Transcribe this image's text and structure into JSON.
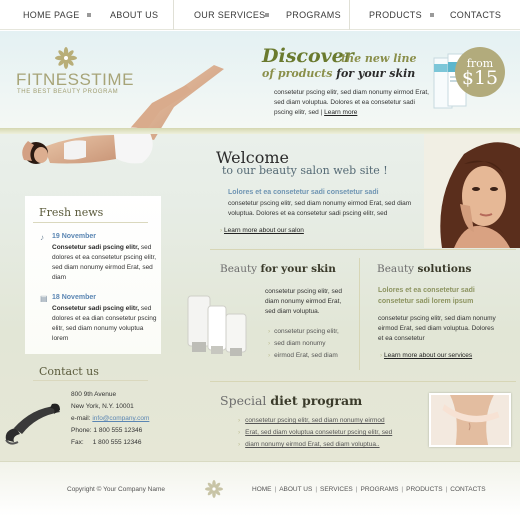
{
  "nav": {
    "items": [
      "HOME PAGE",
      "ABOUT US",
      "OUR SERVICES",
      "PROGRAMS",
      "PRODUCTS",
      "CONTACTS"
    ]
  },
  "logo": {
    "title_a": "FITNESS",
    "title_b": "TIME",
    "subtitle": "THE BEST BEAUTY PROGRAM"
  },
  "discover": {
    "headline": "Discover",
    "line1": "the new line",
    "line2": "of products",
    "line2_b": "for your skin",
    "body": "consetetur pscing elitr, sed diam nonumy eirmod Erat, sed diam voluptua. Dolores et ea consetetur sadi pscing elitr, sed |",
    "more": "Learn more"
  },
  "badge": {
    "from": "from",
    "price": "$15"
  },
  "welcome": {
    "title": "Welcome",
    "subtitle": "to our beauty salon web site !",
    "lead": "Lolores et ea consetetur sadi consetetur sadi",
    "body": "consetetur pscing elitr, sed diam nonumy eirmod Erat, sed diam voluptua. Dolores et ea consetetur sadi pscing elitr, sed",
    "more": "Learn more about our salon"
  },
  "news": {
    "title": "Fresh news",
    "items": [
      {
        "date": "19 November",
        "bold": "Consetetur sadi pscing elitr,",
        "text": "sed dolores et ea consetetur pscing elitr, sed diam nonumy eirmod Erat, sed diam"
      },
      {
        "date": "18 November",
        "bold": "Consetetur sadi pscing elitr,",
        "text": "sed dolores et ea dian consetetur pscing elitr, sed diam nonumy voluptua lorem"
      }
    ]
  },
  "contact": {
    "title": "Contact us",
    "address1": "800 9th Avenue",
    "address2": "New York, N.Y. 10001",
    "email_label": "e-mail:",
    "email": "info@company.com",
    "phone_label": "Phone:",
    "phone": "1 800 555 12346",
    "fax_label": "Fax:",
    "fax": "1 800 555 12346"
  },
  "beauty": {
    "title_a": "Beauty",
    "title_b": "for your skin",
    "text": "consetetur pscing elitr, sed diam nonumy eirmod Erat, sed diam voluptua.",
    "list": [
      "consetetur pscing elitr,",
      "sed diam nonumy",
      "eirmod Erat, sed diam"
    ]
  },
  "solutions": {
    "title_a": "Beauty",
    "title_b": "solutions",
    "lead": "Lolores et ea consetetur sadi consetetur sadi lorem ipsum",
    "body": "consetetur pscing elitr, sed diam nonumy eirmod Erat, sed diam voluptua. Dolores et ea consetetur",
    "more": "Learn more about our services"
  },
  "diet": {
    "title_a": "Special",
    "title_b": "diet program",
    "list": [
      "consetetur pscing elitr, sed diam nonumy eirmod",
      "Erat, sed diam voluptua consetetur pscing elitr, sed",
      "diam nonumy eirmod Erat, sed diam voluptua.."
    ]
  },
  "footer": {
    "copyright": "Copyright © Your Company Name",
    "links": [
      "HOME",
      "ABOUT US",
      "SERVICES",
      "PROGRAMS",
      "PRODUCTS",
      "CONTACTS"
    ]
  },
  "colors": {
    "accent_olive": "#6a7a2e",
    "link_blue": "#5b86b3",
    "badge": "#b2ab7c"
  }
}
